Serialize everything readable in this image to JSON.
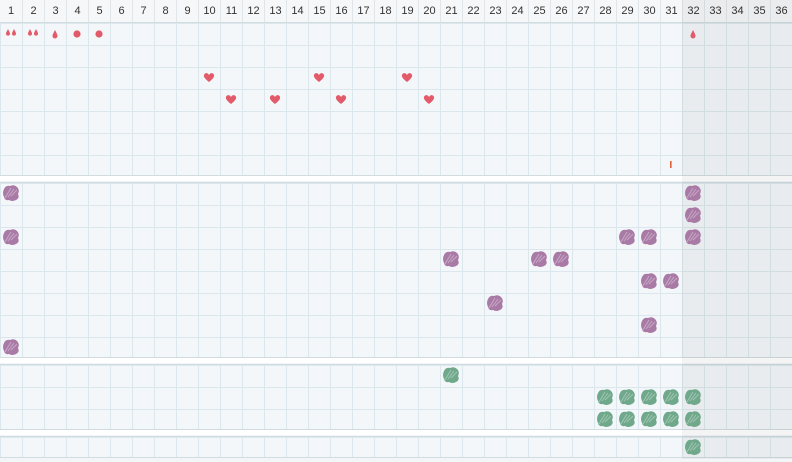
{
  "days": [
    "1",
    "2",
    "3",
    "4",
    "5",
    "6",
    "7",
    "8",
    "9",
    "10",
    "11",
    "12",
    "13",
    "14",
    "15",
    "16",
    "17",
    "18",
    "19",
    "20",
    "21",
    "22",
    "23",
    "24",
    "25",
    "26",
    "27",
    "28",
    "29",
    "30",
    "31",
    "32",
    "33",
    "34",
    "35",
    "36"
  ],
  "today_column": "32",
  "colors": {
    "symptom_red": "#e35a6a",
    "blob_purple": "#a97aa6",
    "blob_green": "#6fa88a",
    "grid_line": "#dbe7ec",
    "shade": "#e8eaec"
  },
  "sections": [
    {
      "name": "symptoms",
      "rows": [
        {
          "marks": [
            {
              "day": "1",
              "icon": "drops-icon"
            },
            {
              "day": "2",
              "icon": "drops-icon"
            },
            {
              "day": "3",
              "icon": "drop-icon"
            },
            {
              "day": "4",
              "icon": "dot-icon"
            },
            {
              "day": "5",
              "icon": "dot-icon"
            },
            {
              "day": "32",
              "icon": "drop-icon"
            }
          ]
        },
        {
          "marks": []
        },
        {
          "marks": [
            {
              "day": "10",
              "icon": "heart-icon"
            },
            {
              "day": "15",
              "icon": "heart-icon"
            },
            {
              "day": "19",
              "icon": "heart-icon"
            }
          ]
        },
        {
          "marks": [
            {
              "day": "11",
              "icon": "heart-icon"
            },
            {
              "day": "13",
              "icon": "heart-icon"
            },
            {
              "day": "16",
              "icon": "heart-icon"
            },
            {
              "day": "20",
              "icon": "heart-icon"
            }
          ]
        },
        {
          "marks": []
        },
        {
          "marks": []
        },
        {
          "marks": [
            {
              "day": "31",
              "icon": "tick-icon"
            }
          ]
        }
      ]
    },
    {
      "name": "purple-activity",
      "rows": [
        {
          "days": [
            "1",
            "32"
          ]
        },
        {
          "days": [
            "32"
          ]
        },
        {
          "days": [
            "1",
            "29",
            "30",
            "32"
          ]
        },
        {
          "days": [
            "21",
            "25",
            "26"
          ]
        },
        {
          "days": [
            "30",
            "31"
          ]
        },
        {
          "days": [
            "23"
          ]
        },
        {
          "days": [
            "30"
          ]
        },
        {
          "days": [
            "1"
          ]
        }
      ]
    },
    {
      "name": "green-activity",
      "rows": [
        {
          "days": [
            "21"
          ]
        },
        {
          "days": [
            "28",
            "29",
            "30",
            "31",
            "32"
          ]
        },
        {
          "days": [
            "28",
            "29",
            "30",
            "31",
            "32"
          ]
        }
      ]
    },
    {
      "name": "bottom-activity",
      "rows": [
        {
          "days": [
            "32"
          ]
        }
      ]
    }
  ]
}
